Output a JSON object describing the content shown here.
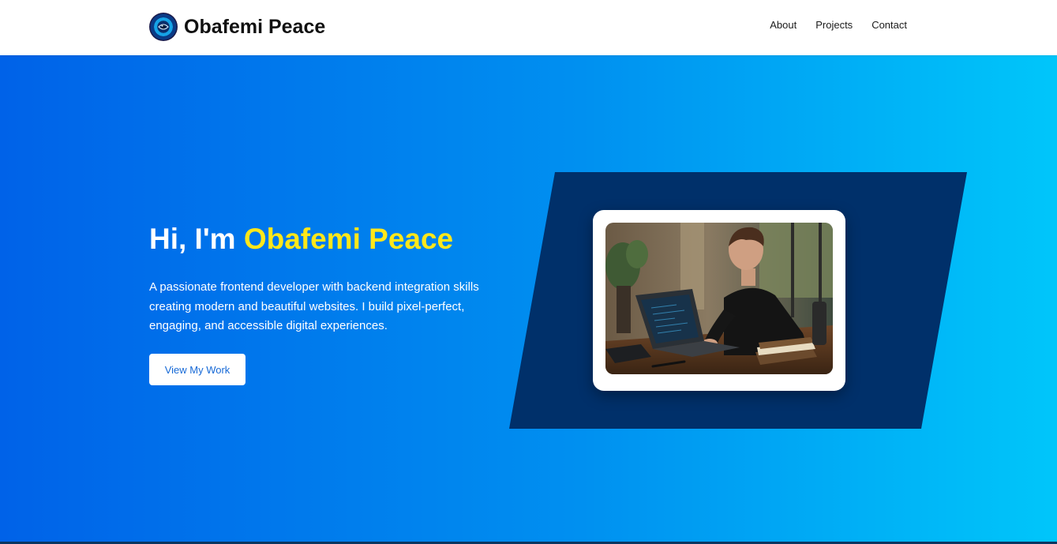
{
  "header": {
    "brand_name": "Obafemi Peace",
    "logo_icon": "eye-logo-icon",
    "nav": [
      {
        "label": "About"
      },
      {
        "label": "Projects"
      },
      {
        "label": "Contact"
      }
    ]
  },
  "hero": {
    "title_prefix": "Hi, I'm ",
    "title_name": "Obafemi Peace",
    "description": "A passionate frontend developer with backend integration skills creating modern and beautiful websites. I build pixel-perfect, engaging, and accessible digital experiences.",
    "cta_label": "View My Work",
    "photo_icon": "developer-at-laptop-photo"
  },
  "colors": {
    "gradient_start": "#0062e8",
    "gradient_end": "#00c6fa",
    "highlight": "#ffe71a",
    "parallelogram": "#00306a",
    "cta_text": "#1669d6"
  }
}
